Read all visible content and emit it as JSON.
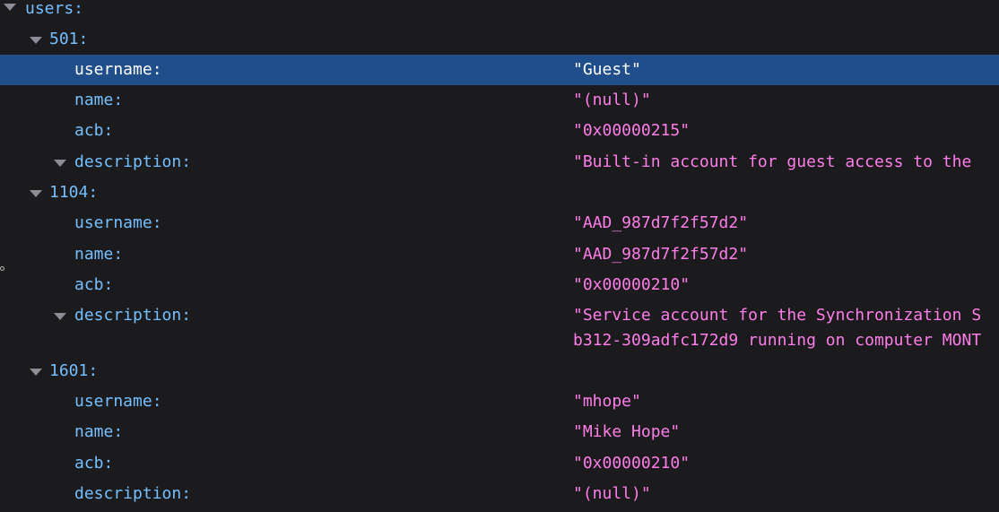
{
  "root": {
    "key": "users:"
  },
  "users": [
    {
      "id_label": "501:",
      "fields": {
        "username": {
          "label": "username:",
          "value": "\"Guest\""
        },
        "name": {
          "label": "name:",
          "value": "\"(null)\""
        },
        "acb": {
          "label": "acb:",
          "value": "\"0x00000215\""
        },
        "description": {
          "label": "description:",
          "value": "\"Built-in account for guest access to the"
        }
      }
    },
    {
      "id_label": "1104:",
      "fields": {
        "username": {
          "label": "username:",
          "value": "\"AAD_987d7f2f57d2\""
        },
        "name": {
          "label": "name:",
          "value": "\"AAD_987d7f2f57d2\""
        },
        "acb": {
          "label": "acb:",
          "value": "\"0x00000210\""
        },
        "description": {
          "label": "description:",
          "value": "\"Service account for the Synchronization S",
          "value_line2": "b312-309adfc172d9 running on computer MONT"
        }
      }
    },
    {
      "id_label": "1601:",
      "fields": {
        "username": {
          "label": "username:",
          "value": "\"mhope\""
        },
        "name": {
          "label": "name:",
          "value": "\"Mike Hope\""
        },
        "acb": {
          "label": "acb:",
          "value": "\"0x00000210\""
        },
        "description": {
          "label": "description:",
          "value": "\"(null)\""
        }
      }
    }
  ],
  "colors": {
    "background": "#1b1b1e",
    "key": "#75bfff",
    "string_value": "#ff7de9",
    "selection": "#204e8a",
    "twisty": "#8c8c96"
  }
}
